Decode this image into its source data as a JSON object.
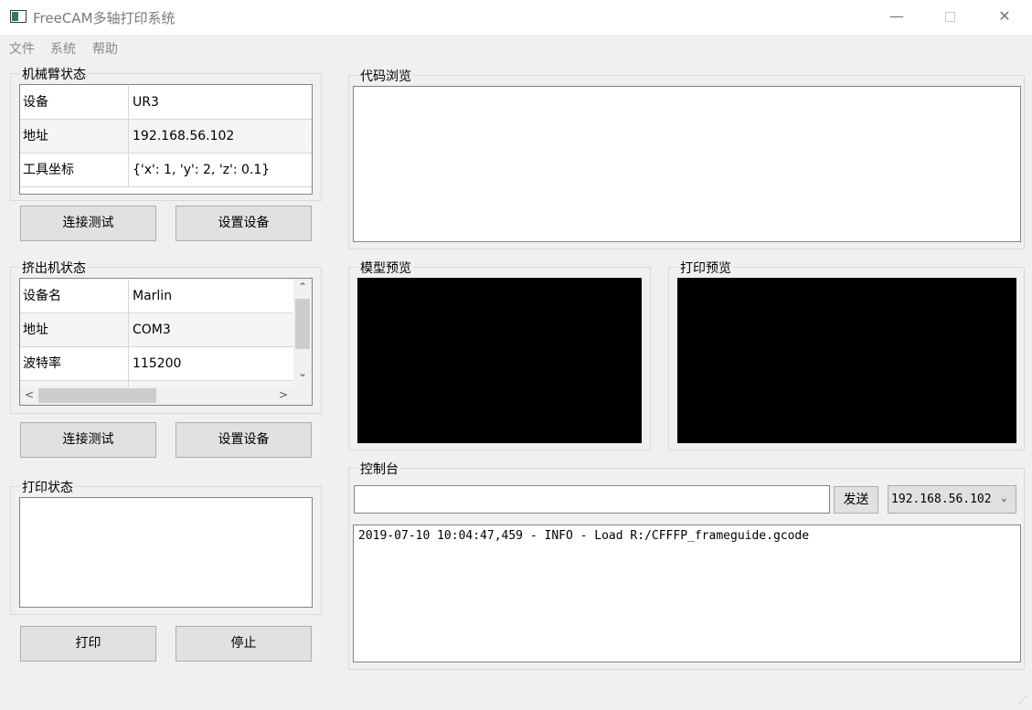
{
  "window": {
    "title": "FreeCAM多轴打印系统",
    "min_glyph": "—",
    "close_glyph": "✕"
  },
  "menu": [
    "文件",
    "系统",
    "帮助"
  ],
  "robot_arm": {
    "title": "机械臂状态",
    "rows": [
      {
        "key": "设备",
        "value": "UR3"
      },
      {
        "key": "地址",
        "value": "192.168.56.102"
      },
      {
        "key": "工具坐标",
        "value": "{'x': 1, 'y': 2, 'z': 0.1}"
      }
    ],
    "buttons": {
      "test": "连接测试",
      "setup": "设置设备"
    }
  },
  "extruder": {
    "title": "挤出机状态",
    "rows": [
      {
        "key": "设备名",
        "value": "Marlin"
      },
      {
        "key": "地址",
        "value": "COM3"
      },
      {
        "key": "波特率",
        "value": "115200"
      }
    ],
    "buttons": {
      "test": "连接测试",
      "setup": "设置设备"
    },
    "scroll": {
      "up": "⌃",
      "down": "⌄",
      "left": "<",
      "right": ">"
    }
  },
  "print_status": {
    "title": "打印状态",
    "buttons": {
      "print": "打印",
      "stop": "停止"
    }
  },
  "code_view": {
    "title": "代码浏览"
  },
  "model_preview": {
    "title": "模型预览"
  },
  "print_preview": {
    "title": "打印预览"
  },
  "console": {
    "title": "控制台",
    "input_value": "",
    "send_label": "发送",
    "target_selected": "192.168.56.102",
    "log": [
      "2019-07-10 10:04:47,459 - INFO - Load R:/CFFFP_frameguide.gcode"
    ]
  },
  "colors": {
    "window_bg": "#f0f0f0",
    "button_bg": "#e1e1e1",
    "preview_bg": "#000000"
  }
}
